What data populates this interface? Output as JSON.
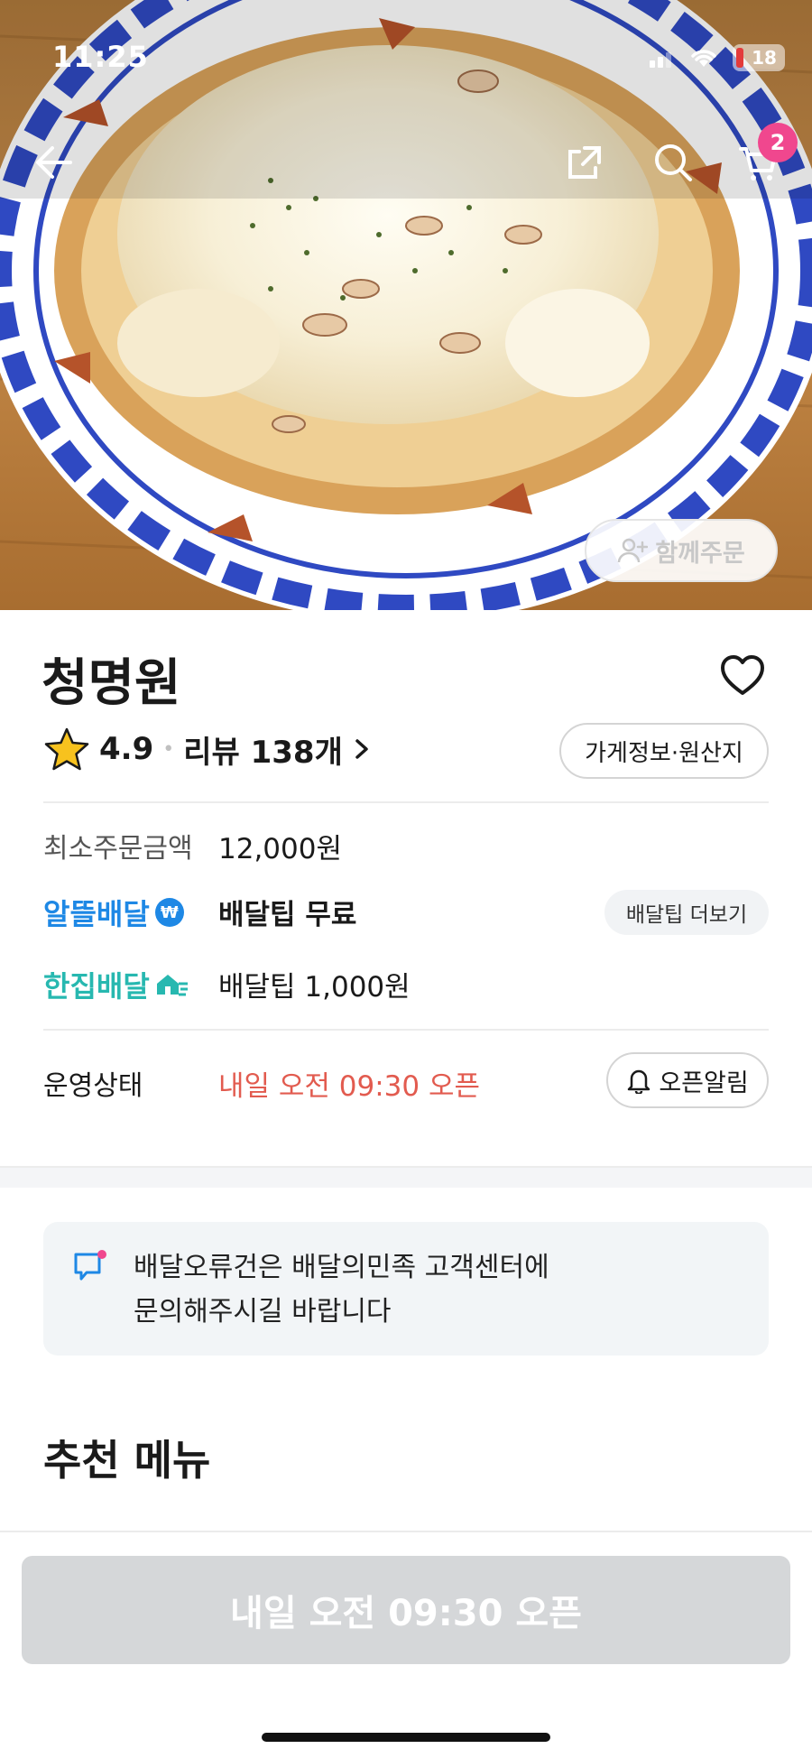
{
  "status_bar": {
    "time": "11:25",
    "battery": "18"
  },
  "header": {
    "cart_count": "2",
    "together_order_label": "함께주문"
  },
  "store": {
    "name": "청명원",
    "rating": "4.9",
    "review_label": "리뷰 138개",
    "info_button": "가게정보·원산지"
  },
  "order_info": {
    "min_order_label": "최소주문금액",
    "min_order_value": "12,000원",
    "alddeul_label": "알뜰배달",
    "alddeul_value": "배달팁 무료",
    "tip_more_button": "배달팁 더보기",
    "hanjip_label": "한집배달",
    "hanjip_value": "배달팁 1,000원",
    "status_label": "운영상태",
    "status_value": "내일 오전 09:30 오픈",
    "alarm_button": "오픈알림"
  },
  "notice": {
    "line1": "배달오류건은 배달의민족 고객센터에",
    "line2": "문의해주시길 바랍니다"
  },
  "recommended": {
    "title": "추천 메뉴"
  },
  "bottom": {
    "open_button": "내일 오전 09:30 오픈"
  },
  "colors": {
    "accent_red": "#e25b4f",
    "alddeul_blue": "#1e88e5",
    "hanjip_teal": "#27b8b0",
    "badge_pink": "#f0478e"
  }
}
